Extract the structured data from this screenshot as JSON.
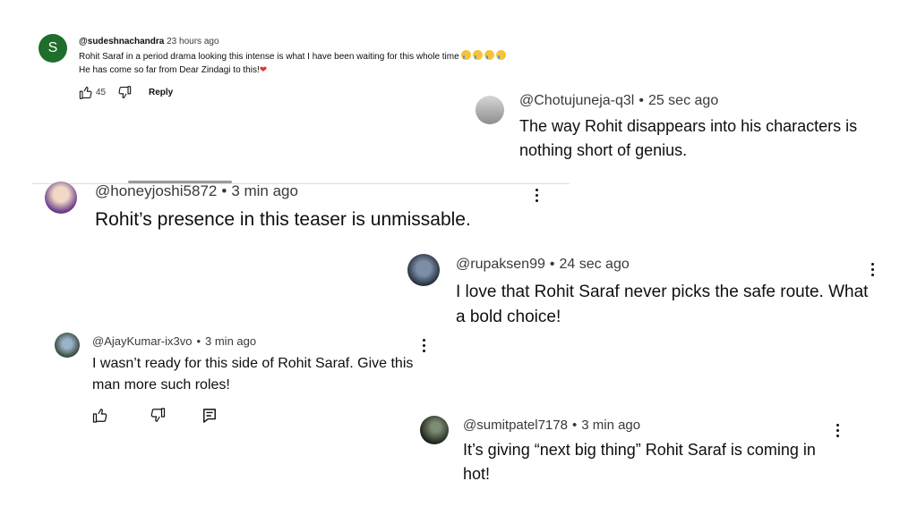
{
  "comments": [
    {
      "avatar_letter": "S",
      "avatar_color": "#1f6e2b",
      "handle": "@sudeshnachandra",
      "time": "23 hours ago",
      "line1": "Rohit Saraf in a period drama looking this intense is what I have been waiting for this whole time",
      "line1_emoji": "loudly-crying-face x4",
      "line2": "He has come so far from Dear Zindagi to this!",
      "line2_emoji": "red-heart",
      "likes": "45",
      "reply_label": "Reply"
    },
    {
      "handle": "@Chotujuneja-q3l",
      "time": "25 sec ago",
      "text": "The way Rohit disappears into his characters is nothing short of genius."
    },
    {
      "handle": "@honeyjoshi5872",
      "time": "3 min ago",
      "text": "Rohit’s presence in this teaser is unmissable."
    },
    {
      "handle": "@rupaksen99",
      "time": "24 sec ago",
      "text": "I love that Rohit Saraf never picks the safe route. What a bold choice!"
    },
    {
      "handle": "@AjayKumar-ix3vo",
      "time": "3 min ago",
      "text": "I wasn’t ready for this side of Rohit Saraf. Give this man more such roles!"
    },
    {
      "handle": "@sumitpatel7178",
      "time": "3 min ago",
      "text": "It’s giving “next big thing” Rohit Saraf is coming in hot!"
    }
  ],
  "separator": "•",
  "icons": {
    "like": "thumbs-up-icon",
    "dislike": "thumbs-down-icon",
    "reply": "comment-reply-icon",
    "more": "kebab-menu-icon"
  }
}
